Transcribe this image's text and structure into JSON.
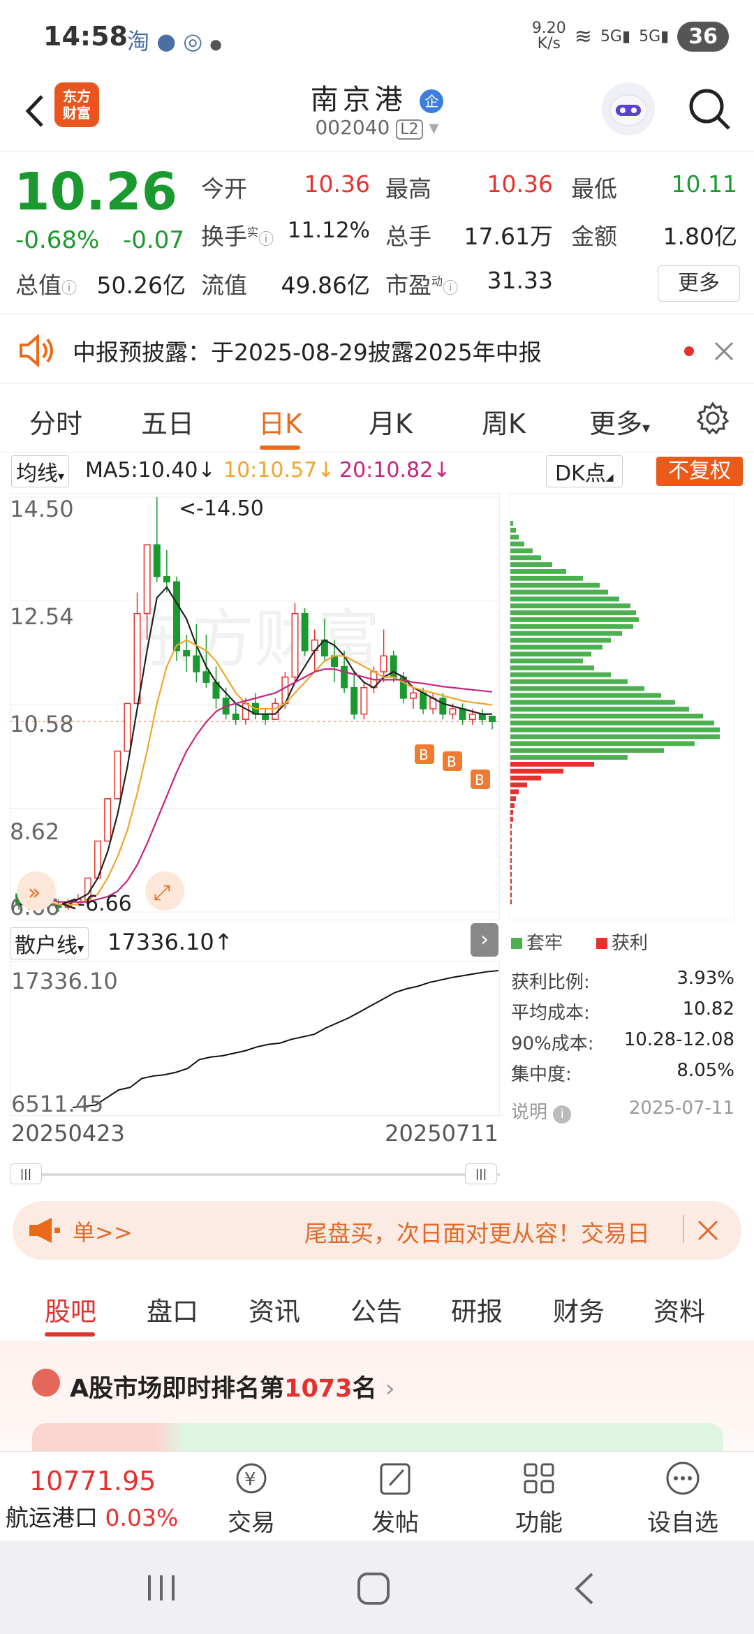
{
  "status": {
    "time": "14:58",
    "net_speed": "9.20\nK/s",
    "net_speed_top": "9.20",
    "net_speed_unit": "K/s",
    "signal1": "5G",
    "signal2": "5G",
    "battery": "36"
  },
  "header": {
    "logo_line1": "东方",
    "logo_line2": "财富",
    "name": "南京港",
    "badge": "企",
    "code": "002040",
    "level": "L2"
  },
  "quote": {
    "price": "10.26",
    "pct": "-0.68%",
    "chg": "-0.07",
    "rows": [
      [
        {
          "label": "今开",
          "value": "10.36"
        },
        {
          "label": "最高",
          "value": "10.36"
        },
        {
          "label": "最低",
          "value": "10.11"
        }
      ],
      [
        {
          "label": "换手",
          "value": "11.12%"
        },
        {
          "label": "总手",
          "value": "17.61万"
        },
        {
          "label": "金额",
          "value": "1.80亿"
        }
      ],
      [
        {
          "label": "总值",
          "value": "50.26亿"
        },
        {
          "label": "流值",
          "value": "49.86亿"
        },
        {
          "label": "市盈",
          "value": "31.33"
        }
      ]
    ],
    "sup_shi": "实",
    "sup_dong": "动",
    "more": "更多"
  },
  "notice": {
    "text": "中报预披露：于2025-08-29披露2025年中报"
  },
  "tabs": [
    "分时",
    "五日",
    "日K",
    "月K",
    "周K",
    "更多"
  ],
  "ma": {
    "selector": "均线",
    "ma5": "MA5:10.40",
    "ma10": "10:10.57",
    "ma20": "20:10.82",
    "arrow": "↓",
    "dk": "DK点",
    "fuquan": "不复权"
  },
  "kchart_labels": {
    "y1": "14.50",
    "y2": "12.54",
    "y3": "10.58",
    "y4": "8.62",
    "y5": "6.66",
    "max_mark": "<-14.50",
    "min_mark": "<-6.66",
    "watermark": "东方财富"
  },
  "chart_data": [
    {
      "type": "candlestick",
      "title": "日K",
      "ylim": [
        6.66,
        14.5
      ],
      "y_ticks": [
        14.5,
        12.54,
        10.58,
        8.62,
        6.66
      ],
      "ohlc": [
        [
          7.0,
          7.1,
          6.7,
          6.8
        ],
        [
          6.8,
          6.9,
          6.7,
          6.9
        ],
        [
          6.9,
          7.0,
          6.8,
          6.8
        ],
        [
          6.8,
          6.9,
          6.7,
          6.8
        ],
        [
          6.8,
          6.9,
          6.66,
          6.75
        ],
        [
          6.75,
          6.9,
          6.7,
          6.85
        ],
        [
          6.85,
          7.0,
          6.8,
          6.9
        ],
        [
          6.9,
          7.3,
          6.9,
          7.3
        ],
        [
          7.3,
          8.0,
          7.3,
          8.0
        ],
        [
          8.0,
          8.8,
          8.0,
          8.8
        ],
        [
          8.8,
          9.7,
          8.8,
          9.7
        ],
        [
          9.7,
          10.6,
          9.7,
          10.6
        ],
        [
          10.6,
          12.7,
          10.6,
          12.3
        ],
        [
          12.3,
          13.6,
          11.8,
          13.6
        ],
        [
          13.6,
          14.5,
          12.9,
          13.0
        ],
        [
          13.0,
          13.5,
          12.7,
          12.9
        ],
        [
          12.9,
          13.0,
          11.4,
          11.6
        ],
        [
          11.6,
          11.9,
          11.2,
          11.5
        ],
        [
          11.5,
          12.1,
          11.0,
          11.2
        ],
        [
          11.2,
          11.9,
          10.9,
          11.0
        ],
        [
          11.0,
          11.3,
          10.5,
          10.7
        ],
        [
          10.7,
          10.9,
          10.3,
          10.4
        ],
        [
          10.4,
          10.6,
          10.2,
          10.3
        ],
        [
          10.3,
          10.7,
          10.2,
          10.6
        ],
        [
          10.6,
          10.8,
          10.3,
          10.4
        ],
        [
          10.4,
          10.5,
          10.2,
          10.3
        ],
        [
          10.3,
          10.7,
          10.3,
          10.6
        ],
        [
          10.6,
          11.2,
          10.5,
          11.1
        ],
        [
          11.1,
          12.5,
          11.0,
          12.3
        ],
        [
          12.3,
          12.4,
          11.5,
          11.6
        ],
        [
          11.6,
          12.0,
          11.2,
          11.8
        ],
        [
          11.8,
          12.2,
          11.4,
          11.5
        ],
        [
          11.5,
          11.8,
          11.0,
          11.3
        ],
        [
          11.3,
          11.6,
          10.8,
          10.9
        ],
        [
          10.9,
          11.2,
          10.3,
          10.4
        ],
        [
          10.4,
          11.0,
          10.3,
          10.9
        ],
        [
          10.9,
          11.3,
          10.8,
          11.2
        ],
        [
          11.2,
          12.0,
          11.0,
          11.5
        ],
        [
          11.5,
          11.6,
          11.0,
          11.1
        ],
        [
          11.1,
          11.2,
          10.6,
          10.7
        ],
        [
          10.7,
          10.9,
          10.5,
          10.8
        ],
        [
          10.8,
          10.9,
          10.4,
          10.5
        ],
        [
          10.5,
          10.8,
          10.4,
          10.7
        ],
        [
          10.7,
          10.8,
          10.3,
          10.4
        ],
        [
          10.4,
          10.6,
          10.3,
          10.5
        ],
        [
          10.5,
          10.6,
          10.2,
          10.3
        ],
        [
          10.3,
          10.5,
          10.2,
          10.4
        ],
        [
          10.4,
          10.5,
          10.2,
          10.3
        ],
        [
          10.36,
          10.36,
          10.11,
          10.26
        ]
      ],
      "series": [
        {
          "name": "MA5",
          "color": "#222222",
          "values": [
            6.8,
            6.8,
            6.8,
            6.8,
            6.8,
            6.8,
            6.9,
            7.0,
            7.3,
            7.8,
            8.5,
            9.4,
            10.5,
            11.6,
            12.6,
            12.8,
            12.5,
            12.2,
            11.7,
            11.3,
            11.0,
            10.8,
            10.6,
            10.5,
            10.4,
            10.4,
            10.4,
            10.6,
            11.0,
            11.3,
            11.6,
            11.8,
            11.7,
            11.5,
            11.2,
            11.0,
            10.9,
            11.1,
            11.2,
            11.1,
            10.9,
            10.8,
            10.7,
            10.6,
            10.55,
            10.5,
            10.45,
            10.4,
            10.4
          ]
        },
        {
          "name": "MA10",
          "color": "#f0a52a",
          "values": [
            6.9,
            6.9,
            6.85,
            6.85,
            6.8,
            6.8,
            6.8,
            6.9,
            7.0,
            7.3,
            7.7,
            8.2,
            8.9,
            9.7,
            10.6,
            11.3,
            11.7,
            11.8,
            11.7,
            11.6,
            11.4,
            11.1,
            10.8,
            10.6,
            10.5,
            10.5,
            10.5,
            10.6,
            10.8,
            11.0,
            11.2,
            11.4,
            11.5,
            11.5,
            11.4,
            11.3,
            11.2,
            11.1,
            11.1,
            11.0,
            10.9,
            10.85,
            10.8,
            10.75,
            10.7,
            10.65,
            10.62,
            10.6,
            10.57
          ]
        },
        {
          "name": "MA20",
          "color": "#c9237d",
          "values": [
            6.9,
            6.9,
            6.9,
            6.9,
            6.85,
            6.85,
            6.85,
            6.85,
            6.9,
            6.95,
            7.05,
            7.25,
            7.55,
            7.95,
            8.4,
            8.85,
            9.3,
            9.7,
            10.0,
            10.25,
            10.45,
            10.55,
            10.6,
            10.65,
            10.7,
            10.75,
            10.8,
            10.9,
            11.0,
            11.1,
            11.2,
            11.25,
            11.25,
            11.2,
            11.15,
            11.1,
            11.05,
            11.05,
            11.05,
            11.05,
            11.0,
            10.98,
            10.95,
            10.92,
            10.9,
            10.88,
            10.86,
            10.84,
            10.82
          ]
        }
      ]
    },
    {
      "type": "line",
      "title": "散户线",
      "ylim": [
        6511.45,
        17336.1
      ],
      "y_ticks": [
        17336.1,
        6511.45
      ],
      "x_start": "20250423",
      "x_end": "20250711",
      "values": [
        6511.45,
        6600,
        6700,
        7300,
        7900,
        8100,
        8800,
        9000,
        9100,
        9300,
        9600,
        10300,
        10500,
        10600,
        10800,
        11000,
        11300,
        11500,
        11600,
        11900,
        12100,
        12300,
        12800,
        13200,
        13600,
        14100,
        14600,
        15100,
        15600,
        15900,
        16100,
        16400,
        16600,
        16800,
        16950,
        17100,
        17250,
        17336.1
      ]
    }
  ],
  "sanhu": {
    "selector": "散户线",
    "value": "17336.10↑",
    "top": "17336.10",
    "bottom": "6511.45",
    "date_start": "20250423",
    "date_end": "20250711"
  },
  "cost": {
    "legend_trap": "套牢",
    "legend_profit": "获利",
    "rows": [
      {
        "k": "获利比例:",
        "v": "3.93%"
      },
      {
        "k": "平均成本:",
        "v": "10.82"
      },
      {
        "k": "90%成本:",
        "v": "10.28-12.08"
      },
      {
        "k": "集中度:",
        "v": "8.05%"
      }
    ],
    "note": "说明",
    "date": "2025-07-11",
    "profile": [
      2,
      4,
      6,
      10,
      16,
      22,
      30,
      40,
      52,
      64,
      70,
      78,
      86,
      90,
      92,
      88,
      80,
      72,
      66,
      58,
      52,
      60,
      72,
      84,
      96,
      108,
      118,
      128,
      138,
      146,
      150,
      150,
      132,
      110,
      84,
      60,
      38,
      22,
      12,
      6,
      4,
      3,
      2,
      2,
      1,
      1,
      1,
      1,
      1,
      1,
      1,
      1,
      1,
      1,
      1,
      1
    ],
    "profile_split": 35
  },
  "promo": {
    "left": "单>>",
    "right": "尾盘买，次日面对更从容！交易日"
  },
  "bottom_tabs": [
    "股吧",
    "盘口",
    "资讯",
    "公告",
    "研报",
    "财务",
    "资料"
  ],
  "rank": {
    "prefix": "A股市场即时排名第",
    "num": "1073",
    "suffix": "名"
  },
  "dock": {
    "index_value": "10771.95",
    "index_name": "航运港口",
    "index_pct": "0.03%",
    "trade": "交易",
    "post": "发帖",
    "func": "功能",
    "watch": "设自选"
  },
  "colors": {
    "up": "#e5312d",
    "down": "#1a9a2e",
    "accent": "#ea6a1a"
  }
}
